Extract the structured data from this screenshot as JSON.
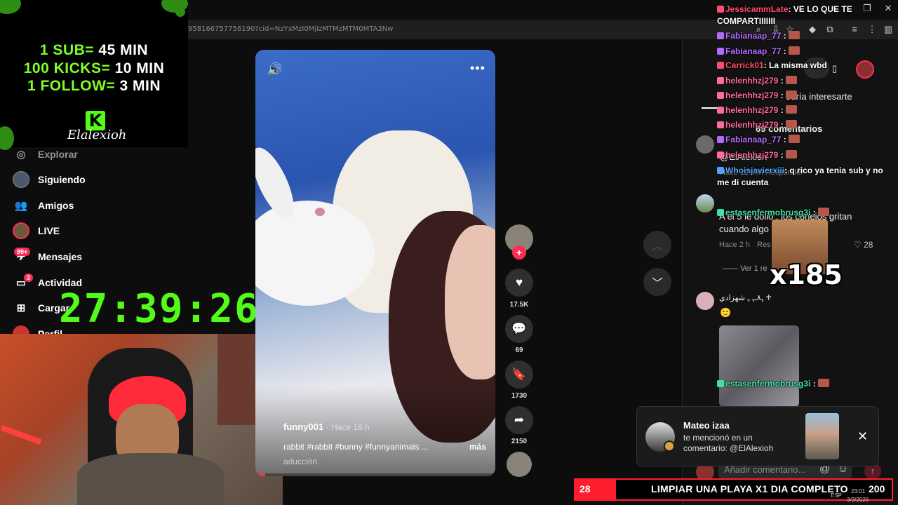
{
  "browser": {
    "url": "958166757756190?cid=NzYxMzI0MjIzMTMzMTM0MTA3Nw"
  },
  "overlay": {
    "goals": [
      {
        "label": "1 SUB=",
        "value": "45 MIN"
      },
      {
        "label": "100 KICKS=",
        "value": "10 MIN"
      },
      {
        "label": "1 FOLLOW=",
        "value": "3 MIN"
      }
    ],
    "logo_letter": "K",
    "channel_name": "Elalexioh",
    "timer": "27:39:26"
  },
  "sidebar": {
    "items": [
      {
        "label": "Explorar",
        "icon": "compass-icon"
      },
      {
        "label": "Siguiendo",
        "icon": "avatar-icon"
      },
      {
        "label": "Amigos",
        "icon": "friends-icon"
      },
      {
        "label": "LIVE",
        "icon": "live-icon"
      },
      {
        "label": "Mensajes",
        "icon": "messages-icon",
        "badge": "99+"
      },
      {
        "label": "Actividad",
        "icon": "activity-icon",
        "badge": "3"
      },
      {
        "label": "Cargar",
        "icon": "upload-icon"
      },
      {
        "label": "Perfil",
        "icon": "profile-icon"
      }
    ]
  },
  "video": {
    "author": "funny001",
    "time": "Hace 18 h",
    "caption": "rabbit #rabbit #bunny #funnyanimals ...",
    "more": "más",
    "translation": "aducción"
  },
  "actions": {
    "likes": "17.5K",
    "comments": "69",
    "saves": "1730",
    "shares": "2150"
  },
  "comments": {
    "interest_text": "odría interesarte",
    "count_text": "69 comentarios",
    "mention": "@ElAlexioh",
    "reply_meta": "Hace 12 min   Responder",
    "c1_text": "A el 5 le dolio , los conejos gritan cuando algo",
    "c1_time": "Hace 2 h",
    "c1_reply": "Res",
    "c1_likes": "28",
    "c1_more": "Ver 1 re",
    "c2_user": "ﮩ٨ـﮩ ﮩ شهزادي ♰",
    "c2_emoji": "🙂",
    "add_comment": "Añadir comentario..."
  },
  "chat": [
    {
      "user": "JessicammLate",
      "color": "#ff4d6d",
      "msg": ": VE LO QUE TE COMPARTIIIIIII"
    },
    {
      "user": "Fabianaap_77",
      "color": "#b36bff",
      "msg": " : "
    },
    {
      "user": "Fabianaap_77",
      "color": "#b36bff",
      "msg": " : "
    },
    {
      "user": "Carrick01",
      "color": "#ff4d6d",
      "msg": ": La misma wbd"
    },
    {
      "user": "helenhhzj279",
      "color": "#ff6b9a",
      "msg": " : "
    },
    {
      "user": "helenhhzj279",
      "color": "#ff6b9a",
      "msg": " : "
    },
    {
      "user": "helenhhzj279",
      "color": "#ff6b9a",
      "msg": " : "
    },
    {
      "user": "helenhhzj279",
      "color": "#ff6b9a",
      "msg": " : "
    },
    {
      "user": "Fabianaap_77",
      "color": "#b36bff",
      "msg": " : "
    },
    {
      "user": "helenhhzj279",
      "color": "#ff6b9a",
      "msg": " : "
    },
    {
      "user": "Whoisjavierxiii",
      "color": "#4da3ff",
      "msg": ": q rico ya tenia sub y no me di cuenta"
    },
    {
      "user": "estasenfermobrusg3i",
      "color": "#40e0a0",
      "msg": " : "
    },
    {
      "user": "estasenfermobrusg3i",
      "color": "#40e0a0",
      "msg": " : "
    }
  ],
  "big_emote": {
    "label": "x185"
  },
  "notification": {
    "user": "Mateo izaa",
    "text1": "te mencionó en un",
    "text2": "comentario: @ElAlexioh"
  },
  "banner": {
    "left_num": "28",
    "text": "LIMPIAR UNA PLAYA X1 DIA COMPLETO",
    "right_num": "200"
  },
  "taskbar": {
    "lang": "ESP",
    "time": "23:01",
    "date": "3/3/2026"
  },
  "colors": {
    "accent": "#fe2c55",
    "kick_green": "#53fc18",
    "banner_red": "#ff1e2d"
  }
}
